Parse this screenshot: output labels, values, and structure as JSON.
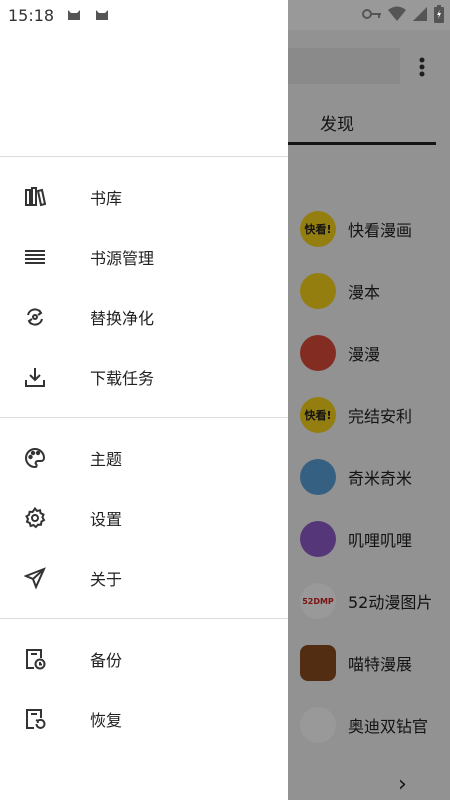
{
  "status_bar": {
    "time": "15:18",
    "icons": [
      "cat-icon",
      "cat-icon",
      "vpn-key-icon",
      "wifi-icon",
      "signal-icon",
      "battery-icon"
    ]
  },
  "drawer": {
    "groups": [
      {
        "items": [
          {
            "icon": "bookshelf-icon",
            "label": "书库"
          },
          {
            "icon": "list-icon",
            "label": "书源管理"
          },
          {
            "icon": "replace-icon",
            "label": "替换净化"
          },
          {
            "icon": "download-icon",
            "label": "下载任务"
          }
        ]
      },
      {
        "items": [
          {
            "icon": "palette-icon",
            "label": "主题"
          },
          {
            "icon": "settings-icon",
            "label": "设置"
          },
          {
            "icon": "send-icon",
            "label": "关于"
          }
        ]
      },
      {
        "items": [
          {
            "icon": "backup-icon",
            "label": "备份"
          },
          {
            "icon": "restore-icon",
            "label": "恢复"
          }
        ]
      }
    ]
  },
  "background": {
    "tab_label": "发现",
    "sources": [
      {
        "name": "快看漫画",
        "logo_text": "快看!",
        "logo_color": "#f6d21a"
      },
      {
        "name": "漫本",
        "logo_text": "",
        "logo_color": "#f6d21a"
      },
      {
        "name": "漫漫",
        "logo_text": "",
        "logo_color": "#d94a3a"
      },
      {
        "name": "完结安利",
        "logo_text": "快看!",
        "logo_color": "#f6d21a"
      },
      {
        "name": "奇米奇米",
        "logo_text": "",
        "logo_color": "#5aa0d8"
      },
      {
        "name": "叽哩叽哩",
        "logo_text": "",
        "logo_color": "#8e5ac8"
      },
      {
        "name": "52动漫图片",
        "logo_text": "52DMP",
        "logo_color": "#ffffff"
      },
      {
        "name": "喵特漫展",
        "logo_text": "",
        "logo_color": "#8a4b1e"
      },
      {
        "name": "奥迪双钻官",
        "logo_text": "",
        "logo_color": "#ffffff"
      }
    ],
    "next_icon": "chevron-right-icon"
  }
}
